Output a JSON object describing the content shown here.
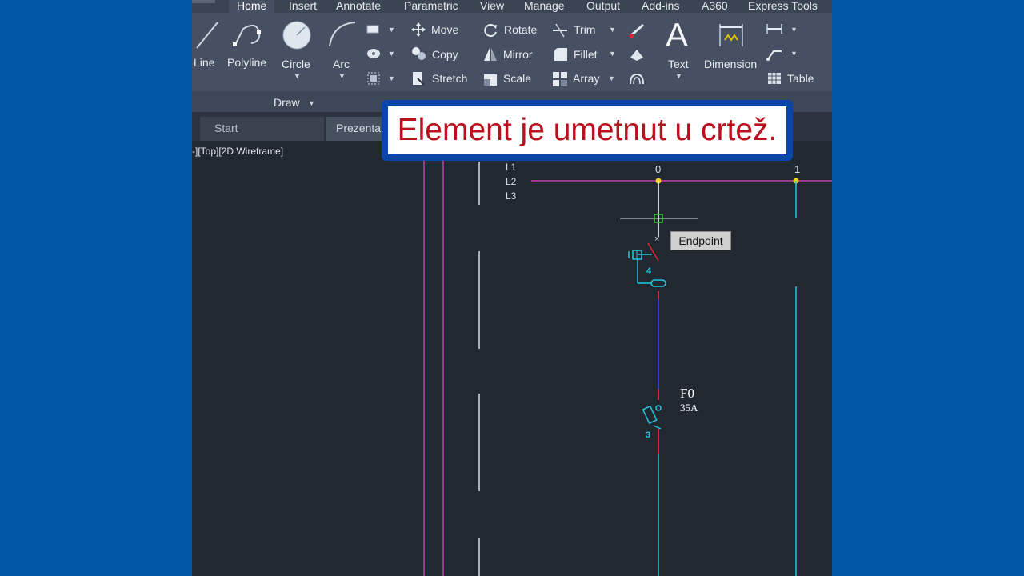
{
  "ribbon_tabs": [
    "Home",
    "Insert",
    "Annotate",
    "Parametric",
    "View",
    "Manage",
    "Output",
    "Add-ins",
    "A360",
    "Express Tools"
  ],
  "draw_tools": {
    "line": "Line",
    "polyline": "Polyline",
    "circle": "Circle",
    "arc": "Arc"
  },
  "draw_panel": {
    "label": "Draw"
  },
  "modify_tools": {
    "move": "Move",
    "copy": "Copy",
    "stretch": "Stretch",
    "rotate": "Rotate",
    "mirror": "Mirror",
    "scale": "Scale",
    "trim": "Trim",
    "fillet": "Fillet",
    "array": "Array"
  },
  "annotation_tools": {
    "text": "Text",
    "dimension": "Dimension",
    "table": "Table"
  },
  "doc_tabs": {
    "start": "Start",
    "drawing": "Prezenta"
  },
  "viewport": {
    "label": "-][Top][2D Wireframe]"
  },
  "drawing": {
    "phases": [
      "L1",
      "L2",
      "L3"
    ],
    "column_0": "0",
    "column_1": "1",
    "contact_no_1": "4",
    "contact_no_2": "3",
    "fuse_name": "F0",
    "fuse_rating": "35A"
  },
  "tooltip": {
    "text": "Endpoint"
  },
  "caption": {
    "text": "Element je umetnut u crtež."
  },
  "colors": {
    "background": "#0257a5",
    "canvas": "#212830",
    "ribbon": "#465062",
    "magenta": "#c83fa8",
    "cyan": "#24c6e0",
    "red": "#e0242f",
    "blue": "#2340d8",
    "caption_red": "#b8121e",
    "caption_border": "#0a46a8"
  }
}
